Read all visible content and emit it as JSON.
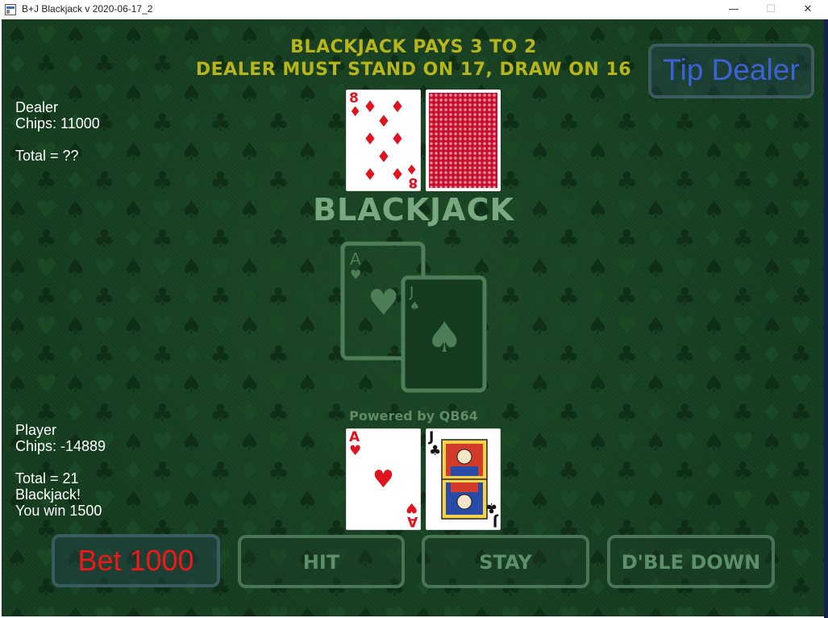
{
  "window": {
    "title": "B+J Blackjack v 2020-06-17_2",
    "minimize": "—",
    "maximize": "☐",
    "close": "✕"
  },
  "rules": {
    "line1": "BLACKJACK PAYS 3 TO 2",
    "line2": "DEALER MUST STAND ON 17, DRAW ON 16"
  },
  "tip_button": {
    "label": "Tip Dealer"
  },
  "dealer": {
    "name": "Dealer",
    "chips": "Chips: 11000",
    "total": "Total = ??",
    "cards": [
      {
        "rank": "8",
        "suit": "♦",
        "color": "red"
      },
      {
        "face_down": true
      }
    ]
  },
  "logo": {
    "title": "BLACKJACK",
    "card1_rank": "A",
    "card2_rank": "J",
    "powered_by": "Powered by QB64"
  },
  "player": {
    "name": "Player",
    "chips": "Chips: -14889",
    "total": "Total = 21",
    "result": "Blackjack!",
    "win": "You win 1500",
    "cards": [
      {
        "rank": "A",
        "suit": "♥",
        "color": "red"
      },
      {
        "rank": "J",
        "suit": "♣",
        "color": "black"
      }
    ]
  },
  "buttons": {
    "bet": "Bet 1000",
    "hit": "HIT",
    "stay": "STAY",
    "double_down": "D'BLE DOWN"
  },
  "colors": {
    "felt": "#143b1e",
    "rules_text": "#b8b51a",
    "tip_text": "#3d62d4",
    "bet_text": "#f01818",
    "button_text": "#5d8f6b"
  }
}
